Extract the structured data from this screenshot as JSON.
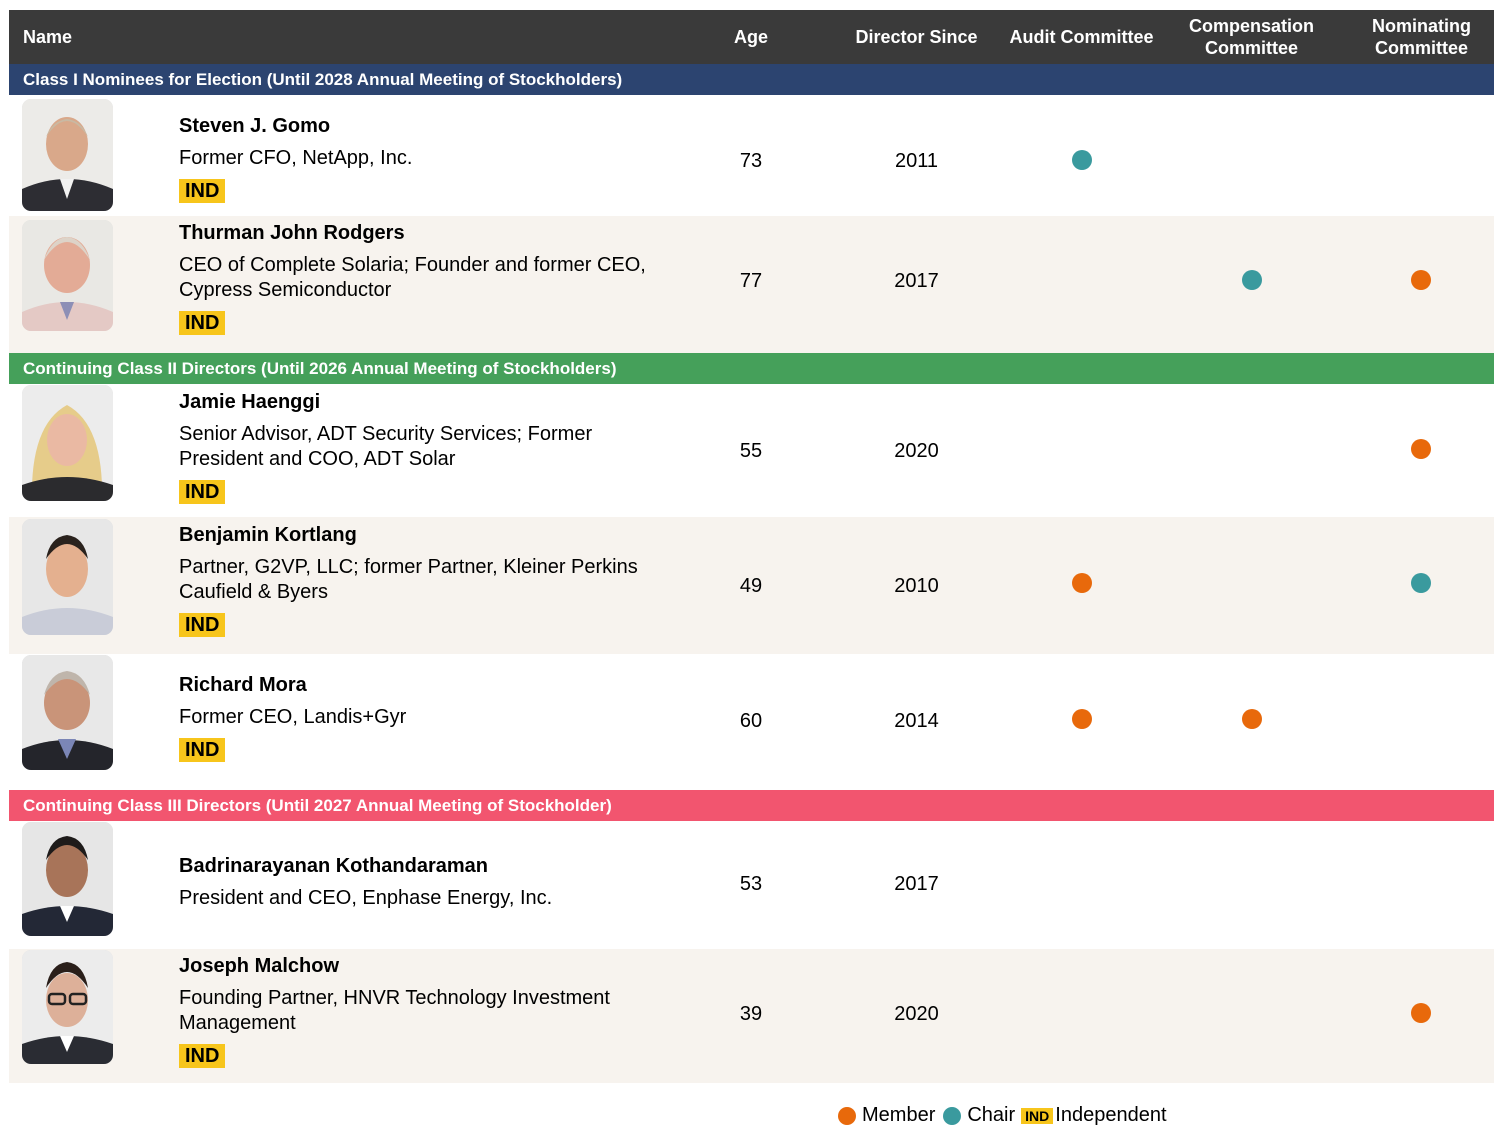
{
  "header": {
    "name": "Name",
    "age": "Age",
    "director_since": "Director Since",
    "audit": "Audit Committee",
    "compensation": "Compensation Committee",
    "nominating": "Nominating Committee"
  },
  "colors": {
    "header_bg": "#3a3a3a",
    "class1": "#2c4470",
    "class2": "#45a05a",
    "class3": "#f2556f",
    "member": "#e8690b",
    "chair": "#3a9a9e",
    "independent": "#f7c51b"
  },
  "sections": [
    {
      "title": "Class I Nominees for Election (Until 2028 Annual Meeting of Stockholders)"
    },
    {
      "title": "Continuing Class II Directors (Until 2026 Annual Meeting of Stockholders)"
    },
    {
      "title": "Continuing Class III Directors (Until 2027 Annual Meeting of Stockholder)"
    }
  ],
  "directors": [
    {
      "name": "Steven J. Gomo",
      "role": "Former CFO, NetApp, Inc.",
      "ind": "IND",
      "age": "73",
      "since": "2011",
      "audit": "chair",
      "compensation": "",
      "nominating": ""
    },
    {
      "name": "Thurman John Rodgers",
      "role": "CEO of Complete Solaria; Founder and former CEO, Cypress Semiconductor",
      "ind": "IND",
      "age": "77",
      "since": "2017",
      "audit": "",
      "compensation": "chair",
      "nominating": "member"
    },
    {
      "name": "Jamie Haenggi",
      "role": "Senior Advisor, ADT Security Services; Former President and COO, ADT Solar",
      "ind": "IND",
      "age": "55",
      "since": "2020",
      "audit": "",
      "compensation": "",
      "nominating": "member"
    },
    {
      "name": "Benjamin Kortlang",
      "role": "Partner, G2VP, LLC; former Partner, Kleiner Perkins Caufield & Byers",
      "ind": "IND",
      "age": "49",
      "since": "2010",
      "audit": "member",
      "compensation": "",
      "nominating": "chair"
    },
    {
      "name": "Richard Mora",
      "role": "Former CEO, Landis+Gyr",
      "ind": "IND",
      "age": "60",
      "since": "2014",
      "audit": "member",
      "compensation": "member",
      "nominating": ""
    },
    {
      "name": "Badrinarayanan Kothandaraman",
      "role": "President and CEO, Enphase Energy, Inc.",
      "ind": "",
      "age": "53",
      "since": "2017",
      "audit": "",
      "compensation": "",
      "nominating": ""
    },
    {
      "name": "Joseph Malchow",
      "role": "Founding Partner, HNVR Technology Investment Management",
      "ind": "IND",
      "age": "39",
      "since": "2020",
      "audit": "",
      "compensation": "",
      "nominating": "member"
    }
  ],
  "legend": {
    "member": "Member",
    "chair": "Chair",
    "ind_badge": "IND",
    "independent": "Independent"
  }
}
